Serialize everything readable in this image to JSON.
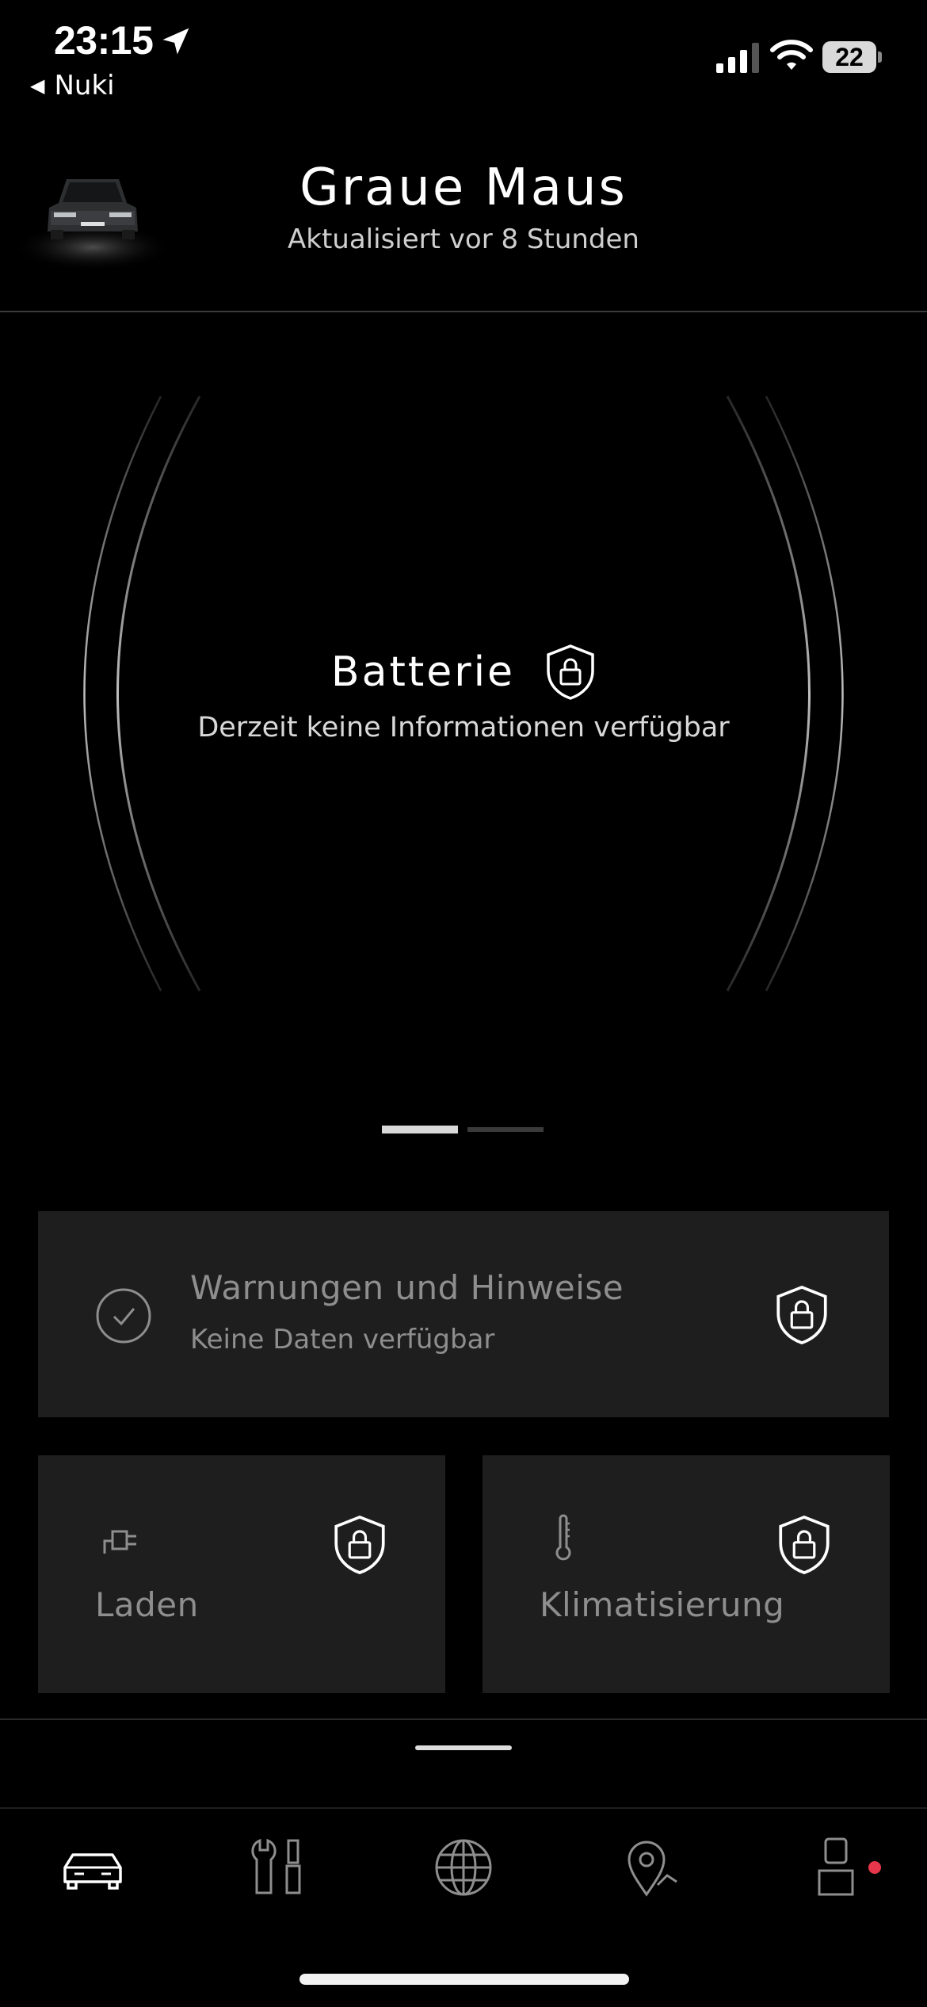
{
  "status_bar": {
    "time": "23:15",
    "back_label": "Nuki",
    "battery_level": "22",
    "icons": [
      "location-arrow-icon",
      "cell-signal-icon",
      "wifi-icon",
      "battery-icon"
    ]
  },
  "header": {
    "title": "Graue Maus",
    "subtitle": "Aktualisiert vor 8 Stunden"
  },
  "battery_panel": {
    "title": "Batterie",
    "subtitle": "Derzeit keine Informationen verfügbar",
    "page_index": 0,
    "page_count": 2
  },
  "cards": {
    "warnings": {
      "title": "Warnungen und Hinweise",
      "subtitle": "Keine Daten verfügbar"
    },
    "charging": {
      "label": "Laden"
    },
    "climate": {
      "label": "Klimatisierung"
    }
  },
  "tab_bar": {
    "items": [
      {
        "name": "vehicle",
        "icon": "car-icon",
        "active": true
      },
      {
        "name": "service",
        "icon": "tools-icon",
        "active": false
      },
      {
        "name": "explore",
        "icon": "globe-icon",
        "active": false
      },
      {
        "name": "map",
        "icon": "map-pin-icon",
        "active": false
      },
      {
        "name": "profile",
        "icon": "profile-icon",
        "active": false,
        "badge": true
      }
    ]
  },
  "colors": {
    "background": "#000000",
    "card": "#1e1e1e",
    "muted_text": "#8e8e8e",
    "notification": "#e8364a"
  }
}
